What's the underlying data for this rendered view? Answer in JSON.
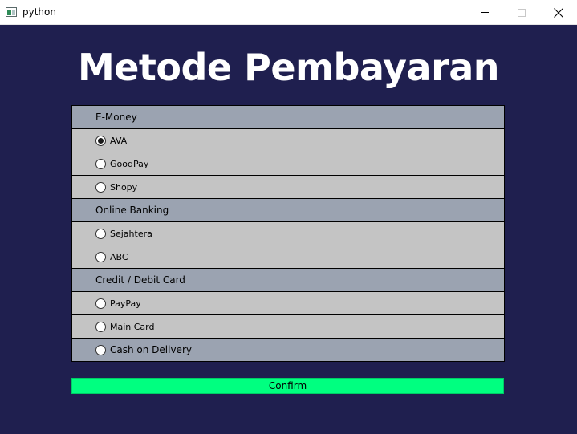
{
  "window": {
    "title": "python"
  },
  "heading": "Metode Pembayaran",
  "groups": [
    {
      "label": "E-Money",
      "options": [
        {
          "label": "AVA",
          "selected": true
        },
        {
          "label": "GoodPay",
          "selected": false
        },
        {
          "label": "Shopy",
          "selected": false
        }
      ]
    },
    {
      "label": "Online Banking",
      "options": [
        {
          "label": "Sejahtera",
          "selected": false
        },
        {
          "label": "ABC",
          "selected": false
        }
      ]
    },
    {
      "label": "Credit / Debit Card",
      "options": [
        {
          "label": "PayPay",
          "selected": false
        },
        {
          "label": "Main Card",
          "selected": false
        }
      ]
    }
  ],
  "cod_option": {
    "label": "Cash on Delivery",
    "selected": false
  },
  "confirm_label": "Confirm",
  "colors": {
    "background": "#1f1f4f",
    "group_header": "#9ba3b1",
    "option_row": "#c4c4c4",
    "confirm_button": "#00ff80"
  }
}
